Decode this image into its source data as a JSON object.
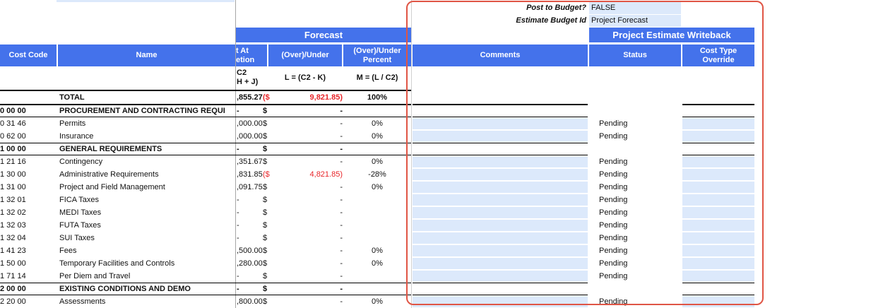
{
  "settings": {
    "post_to_budget_label": "Post to Budget?",
    "post_to_budget_value": "FALSE",
    "estimate_budget_id_label": "Estimate Budget Id",
    "estimate_budget_id_value": "Project Forecast"
  },
  "headers": {
    "forecast": "Forecast",
    "writeback": "Project Estimate Writeback",
    "cost_code": "Cost Code",
    "name": "Name",
    "eac_line1": "t At",
    "eac_line2": "etion",
    "over_under": "(Over)/Under",
    "over_under_pct_line1": "(Over)/Under",
    "over_under_pct_line2": "Percent",
    "comments": "Comments",
    "status": "Status",
    "cost_type_override_line1": "Cost Type",
    "cost_type_override_line2": "Override"
  },
  "formulas": {
    "eac_line1": "C2",
    "eac_line2": "H + J)",
    "over_under": "L = (C2 - K)",
    "pct": "M = (L / C2)"
  },
  "total": {
    "name": "TOTAL",
    "eac": ",855.27",
    "dollar": "($",
    "over_under": "9,821.85)",
    "pct": "100%"
  },
  "rows": [
    {
      "code": "0 00 00",
      "name": "PROCUREMENT AND CONTRACTING REQUI",
      "eac": "-",
      "dollar": "$",
      "over_under": "-",
      "pct": "",
      "status": "",
      "bold": true,
      "red": false
    },
    {
      "code": "0 31 46",
      "name": "Permits",
      "eac": ",000.00",
      "dollar": "$",
      "over_under": "-",
      "pct": "0%",
      "status": "Pending",
      "bold": false,
      "red": false
    },
    {
      "code": "0 62 00",
      "name": "Insurance",
      "eac": ",000.00",
      "dollar": "$",
      "over_under": "-",
      "pct": "0%",
      "status": "Pending",
      "bold": false,
      "red": false
    },
    {
      "code": "1 00 00",
      "name": "GENERAL REQUIREMENTS",
      "eac": "-",
      "dollar": "$",
      "over_under": "-",
      "pct": "",
      "status": "",
      "bold": true,
      "red": false
    },
    {
      "code": "1 21 16",
      "name": "Contingency",
      "eac": ",351.67",
      "dollar": "$",
      "over_under": "-",
      "pct": "0%",
      "status": "Pending",
      "bold": false,
      "red": false
    },
    {
      "code": "1 30 00",
      "name": "Administrative Requirements",
      "eac": ",831.85",
      "dollar": "($",
      "over_under": "4,821.85)",
      "pct": "-28%",
      "status": "Pending",
      "bold": false,
      "red": true
    },
    {
      "code": "1 31 00",
      "name": "Project and Field Management",
      "eac": ",091.75",
      "dollar": "$",
      "over_under": "-",
      "pct": "0%",
      "status": "Pending",
      "bold": false,
      "red": false
    },
    {
      "code": "1 32 01",
      "name": "FICA Taxes",
      "eac": "-",
      "dollar": "$",
      "over_under": "-",
      "pct": "",
      "status": "Pending",
      "bold": false,
      "red": false
    },
    {
      "code": "1 32 02",
      "name": "MEDI Taxes",
      "eac": "-",
      "dollar": "$",
      "over_under": "-",
      "pct": "",
      "status": "Pending",
      "bold": false,
      "red": false
    },
    {
      "code": "1 32 03",
      "name": "FUTA Taxes",
      "eac": "-",
      "dollar": "$",
      "over_under": "-",
      "pct": "",
      "status": "Pending",
      "bold": false,
      "red": false
    },
    {
      "code": "1 32 04",
      "name": "SUI Taxes",
      "eac": "-",
      "dollar": "$",
      "over_under": "-",
      "pct": "",
      "status": "Pending",
      "bold": false,
      "red": false
    },
    {
      "code": "1 41 23",
      "name": "Fees",
      "eac": ",500.00",
      "dollar": "$",
      "over_under": "-",
      "pct": "0%",
      "status": "Pending",
      "bold": false,
      "red": false
    },
    {
      "code": "1 50 00",
      "name": "Temporary Facilities and Controls",
      "eac": ",280.00",
      "dollar": "$",
      "over_under": "-",
      "pct": "0%",
      "status": "Pending",
      "bold": false,
      "red": false
    },
    {
      "code": "1 71 14",
      "name": "Per Diem and Travel",
      "eac": "-",
      "dollar": "$",
      "over_under": "-",
      "pct": "",
      "status": "Pending",
      "bold": false,
      "red": false
    },
    {
      "code": "2 00 00",
      "name": "EXISTING CONDITIONS AND DEMO",
      "eac": "-",
      "dollar": "$",
      "over_under": "-",
      "pct": "",
      "status": "",
      "bold": true,
      "red": false
    },
    {
      "code": "2 20 00",
      "name": "Assessments",
      "eac": ",800.00",
      "dollar": "$",
      "over_under": "-",
      "pct": "0%",
      "status": "Pending",
      "bold": false,
      "red": false
    }
  ]
}
